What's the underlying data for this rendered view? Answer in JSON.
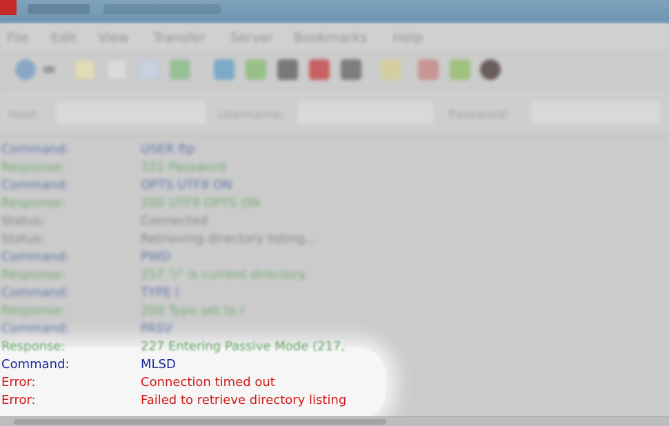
{
  "menu": [
    "File",
    "Edit",
    "View",
    "Transfer",
    "Server",
    "Bookmarks",
    "Help"
  ],
  "toolbar_icons": [
    "site-manager-icon",
    "dropdown-arrow-icon",
    "message-log-icon",
    "local-tree-icon",
    "remote-tree-icon",
    "transfer-queue-icon",
    "refresh-icon",
    "process-queue-icon",
    "cancel-icon",
    "disconnect-icon",
    "reconnect-icon",
    "directory-filter-icon",
    "compare-icon",
    "sync-browse-icon",
    "search-icon"
  ],
  "quickconnect": {
    "host_label": "Host:",
    "username_label": "Username:",
    "password_label": "Password:"
  },
  "log": [
    {
      "type": "Command:",
      "message": "USER ftp",
      "kind": "cmd"
    },
    {
      "type": "Response:",
      "message": "331 Password",
      "kind": "resp"
    },
    {
      "type": "Command:",
      "message": "OPTS UTF8 ON",
      "kind": "cmd"
    },
    {
      "type": "Response:",
      "message": "200 UTF8 OPTS ON",
      "kind": "resp"
    },
    {
      "type": "Status:",
      "message": "Connected",
      "kind": "stat"
    },
    {
      "type": "Status:",
      "message": "Retrieving directory listing...",
      "kind": "stat"
    },
    {
      "type": "Command:",
      "message": "PWD",
      "kind": "cmd"
    },
    {
      "type": "Response:",
      "message": "257 \"/\" is current directory.",
      "kind": "resp"
    },
    {
      "type": "Command:",
      "message": "TYPE I",
      "kind": "cmd"
    },
    {
      "type": "Response:",
      "message": "200 Type set to I",
      "kind": "resp"
    },
    {
      "type": "Command:",
      "message": "PASV",
      "kind": "cmd"
    },
    {
      "type": "Response:",
      "message": "227 Entering Passive Mode (217,",
      "kind": "resp"
    },
    {
      "type": "Command:",
      "message": "MLSD",
      "kind": "cmd"
    },
    {
      "type": "Error:",
      "message": "Connection timed out",
      "kind": "err"
    },
    {
      "type": "Error:",
      "message": "Failed to retrieve directory listing",
      "kind": "err"
    }
  ],
  "colors": {
    "command": "#1a2a9c",
    "response": "#3a8a3a",
    "error": "#d11818"
  }
}
